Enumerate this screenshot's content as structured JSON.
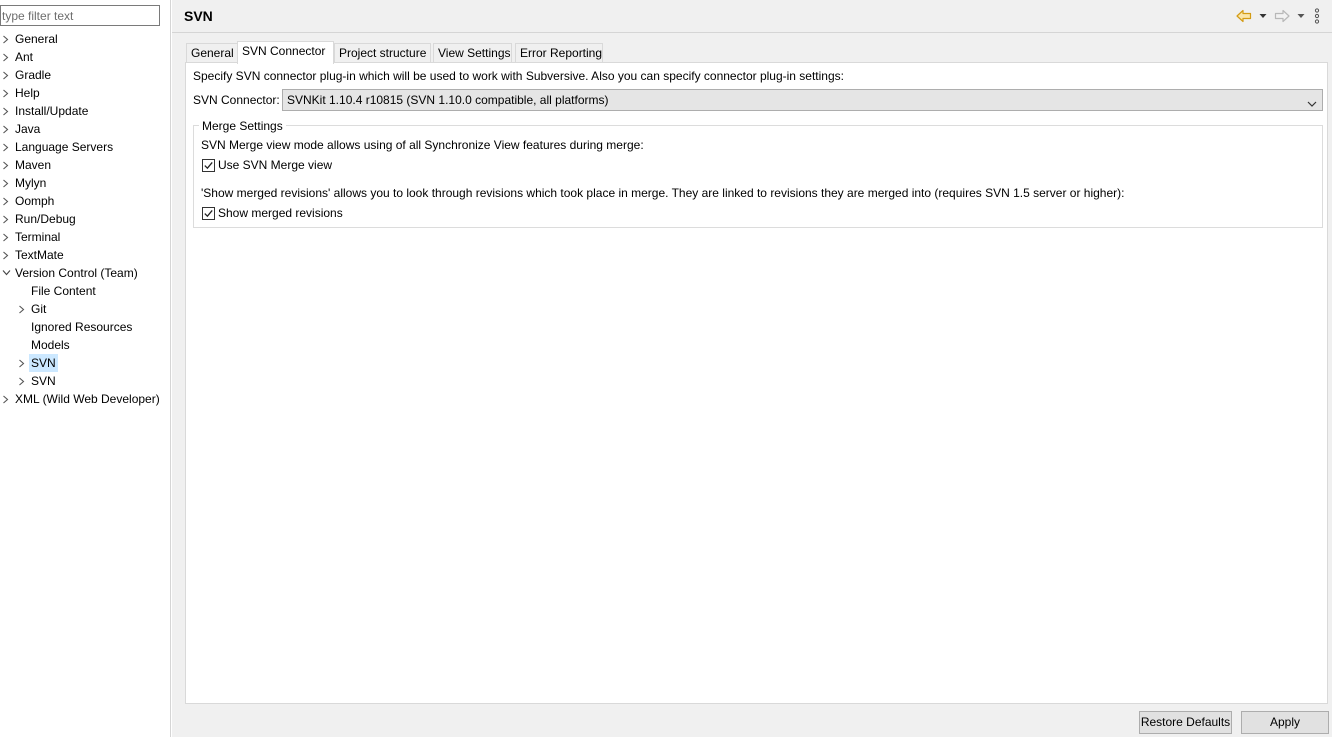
{
  "filter": {
    "placeholder": "type filter text"
  },
  "tree": [
    {
      "label": "General",
      "level": 0,
      "twisty": "collapsed"
    },
    {
      "label": "Ant",
      "level": 0,
      "twisty": "collapsed"
    },
    {
      "label": "Gradle",
      "level": 0,
      "twisty": "collapsed"
    },
    {
      "label": "Help",
      "level": 0,
      "twisty": "collapsed"
    },
    {
      "label": "Install/Update",
      "level": 0,
      "twisty": "collapsed"
    },
    {
      "label": "Java",
      "level": 0,
      "twisty": "collapsed"
    },
    {
      "label": "Language Servers",
      "level": 0,
      "twisty": "collapsed"
    },
    {
      "label": "Maven",
      "level": 0,
      "twisty": "collapsed"
    },
    {
      "label": "Mylyn",
      "level": 0,
      "twisty": "collapsed"
    },
    {
      "label": "Oomph",
      "level": 0,
      "twisty": "collapsed"
    },
    {
      "label": "Run/Debug",
      "level": 0,
      "twisty": "collapsed"
    },
    {
      "label": "Terminal",
      "level": 0,
      "twisty": "collapsed"
    },
    {
      "label": "TextMate",
      "level": 0,
      "twisty": "collapsed"
    },
    {
      "label": "Version Control (Team)",
      "level": 0,
      "twisty": "expanded"
    },
    {
      "label": "File Content",
      "level": 1,
      "twisty": "none"
    },
    {
      "label": "Git",
      "level": 1,
      "twisty": "collapsed"
    },
    {
      "label": "Ignored Resources",
      "level": 1,
      "twisty": "none"
    },
    {
      "label": "Models",
      "level": 1,
      "twisty": "none"
    },
    {
      "label": "SVN",
      "level": 1,
      "twisty": "collapsed",
      "selected": true
    },
    {
      "label": "SVN",
      "level": 1,
      "twisty": "collapsed"
    },
    {
      "label": "XML (Wild Web Developer)",
      "level": 0,
      "twisty": "collapsed"
    }
  ],
  "header": {
    "title": "SVN",
    "icons": {
      "back": "back-arrow-icon",
      "forward": "forward-arrow-icon",
      "menu": "view-menu-icon"
    },
    "back_color": "#e8a317"
  },
  "tabs": [
    {
      "label": "General"
    },
    {
      "label": "SVN Connector",
      "active": true
    },
    {
      "label": "Project structure"
    },
    {
      "label": "View Settings"
    },
    {
      "label": "Error Reporting"
    }
  ],
  "panel": {
    "description": "Specify SVN connector plug-in which will be used to work with Subversive. Also you can specify connector plug-in settings:",
    "connector_label": "SVN Connector:",
    "connector_value": "SVNKit 1.10.4 r10815 (SVN 1.10.0 compatible, all platforms)",
    "merge": {
      "title": "Merge Settings",
      "mode_text": "SVN Merge view mode allows using of all Synchronize View features during merge:",
      "use_merge_view_label": "Use SVN Merge view",
      "use_merge_view_checked": true,
      "revisions_text": "'Show merged revisions' allows you to look through revisions which took place in merge. They are linked to revisions they are merged into (requires SVN 1.5 server or higher):",
      "show_revisions_label": "Show merged revisions",
      "show_revisions_checked": true
    }
  },
  "buttons": {
    "restore": "Restore Defaults",
    "apply": "Apply"
  },
  "colors": {
    "selection": "#cce8ff",
    "window_bg": "#f0f0f0"
  }
}
